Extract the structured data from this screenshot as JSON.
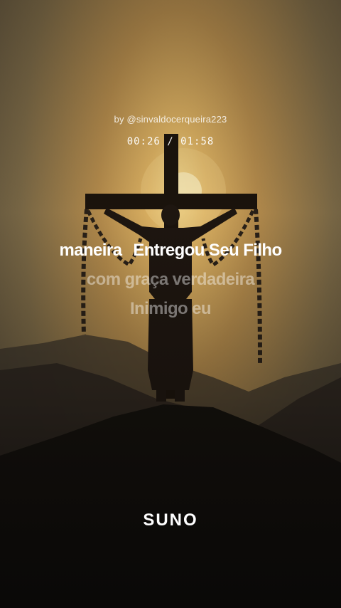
{
  "video": {
    "byline": "by @sinvaldocerqueira223",
    "elapsed": "00:26",
    "separator": "/",
    "duration": "01:58",
    "progress_fraction": 0.22
  },
  "lyrics": {
    "current_line_a": "maneira",
    "current_line_b": "Entregou Seu Filho",
    "next_line": "com graça verdadeira",
    "following_line": "Inimigo eu"
  },
  "brand": {
    "logo_text": "SUNO"
  },
  "colors": {
    "lyric_active": "#ffffff",
    "lyric_upcoming": "rgba(255,255,255,0.42)",
    "sky_glow": "#f6d98a"
  },
  "icons": {
    "background": "crucifixion-sunset-image"
  }
}
